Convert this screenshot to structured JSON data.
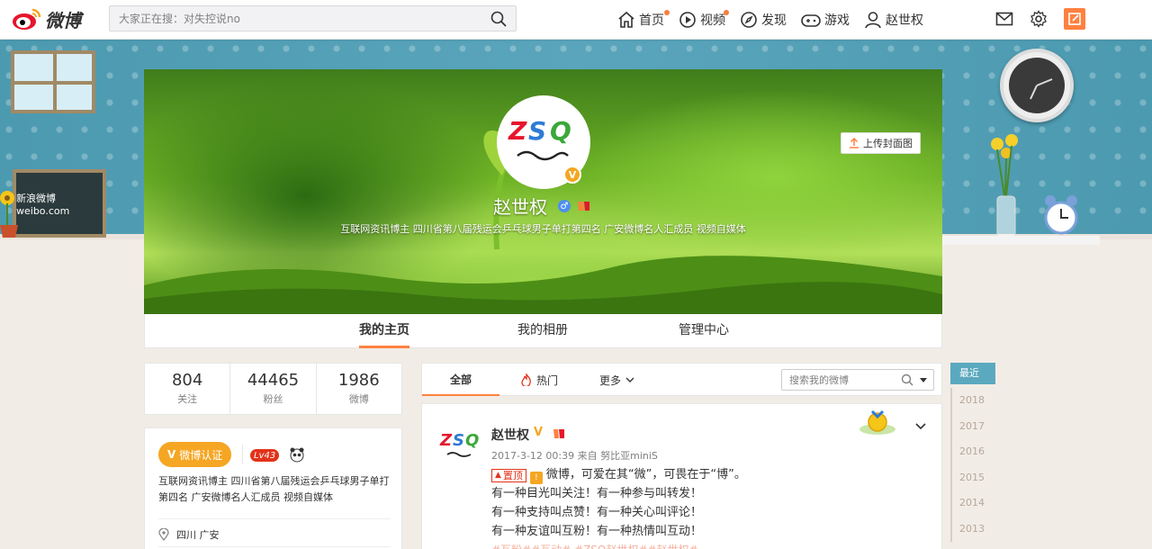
{
  "topnav": {
    "logo_text": "微博",
    "search_placeholder": "大家正在搜：对失控说no",
    "items": [
      {
        "label": "首页"
      },
      {
        "label": "视频"
      },
      {
        "label": "发现"
      },
      {
        "label": "游戏"
      },
      {
        "label": "赵世权"
      }
    ],
    "icons": [
      "mail-icon",
      "settings-icon",
      "compose-icon"
    ]
  },
  "decor": {
    "board_text": "新浪微博 weibo.com"
  },
  "cover": {
    "upload_label": "上传封面图",
    "name": "赵世权",
    "verified_badge": "V",
    "bio": "互联网资讯博主 四川省第八届残运会乒乓球男子单打第四名 广安微博名人汇成员 视频自媒体",
    "colors": {
      "accent": "#ff8140",
      "verified": "#f5a623"
    }
  },
  "profile_tabs": [
    {
      "label": "我的主页",
      "active": true
    },
    {
      "label": "我的相册",
      "active": false
    },
    {
      "label": "管理中心",
      "active": false
    }
  ],
  "stats": [
    {
      "value": "804",
      "label": "关注"
    },
    {
      "value": "44465",
      "label": "粉丝"
    },
    {
      "value": "1986",
      "label": "微博"
    }
  ],
  "info": {
    "cert_label": "微博认证",
    "level": "Lv43",
    "desc": "互联网资讯博主 四川省第八届残运会乒乓球男子单打第四名 广安微博名人汇成员 视频自媒体",
    "location": "四川 广安"
  },
  "feed_tabs": {
    "all": "全部",
    "hot": "热门",
    "more": "更多",
    "search_placeholder": "搜索我的微博"
  },
  "post": {
    "author": "赵世权",
    "verified": "V",
    "meta": "2017-3-12 00:39 来自 努比亚miniS",
    "pinned_tag": "置顶",
    "lines": [
      "微博，可爱在其“微”，可畏在于“博”。",
      "有一种目光叫关注！有一种参与叫转发！",
      "有一种支持叫点赞！有一种关心叫评论！",
      "有一种友谊叫互粉！有一种热情叫互动！",
      "#互粉##互动# #ZSQ赵世权##赵世权#"
    ]
  },
  "timeline": [
    {
      "label": "最近",
      "active": true
    },
    {
      "label": "2018",
      "active": false
    },
    {
      "label": "2017",
      "active": false
    },
    {
      "label": "2016",
      "active": false
    },
    {
      "label": "2015",
      "active": false
    },
    {
      "label": "2014",
      "active": false
    },
    {
      "label": "2013",
      "active": false
    }
  ]
}
